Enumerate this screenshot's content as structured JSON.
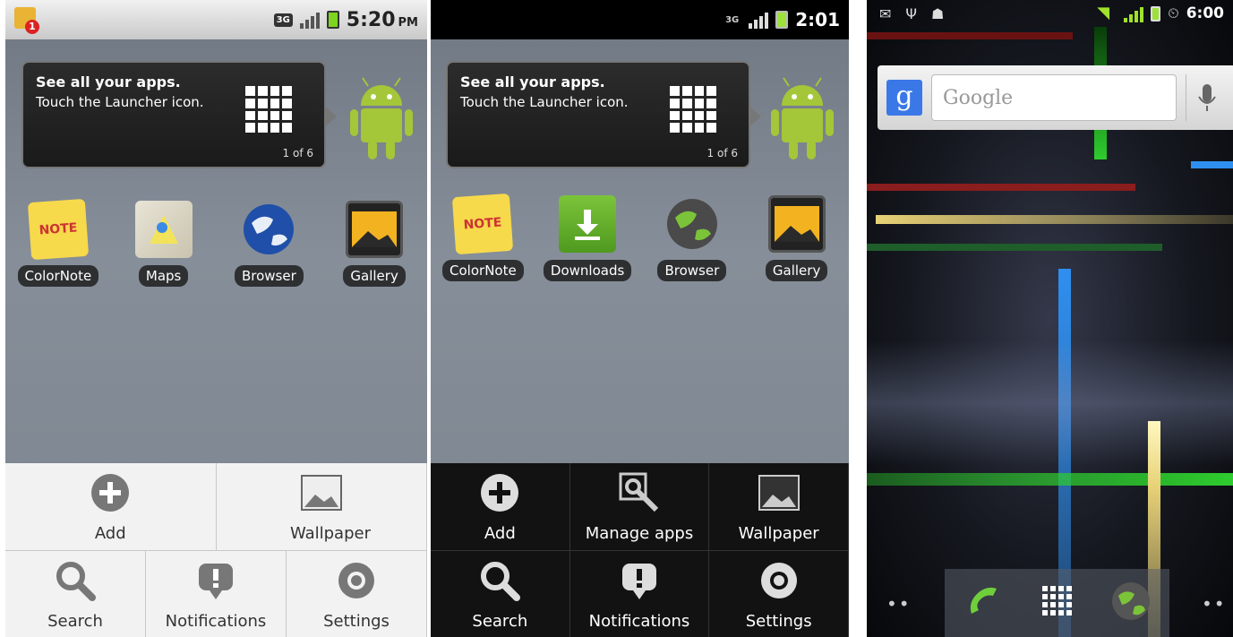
{
  "screen1": {
    "status": {
      "time": "5:20",
      "ampm": "PM",
      "network": "3G",
      "notification_count": "1"
    },
    "tip": {
      "title": "See all your apps.",
      "body": "Touch the Launcher icon.",
      "page": "1 of 6"
    },
    "apps": [
      {
        "label": "ColorNote",
        "icon": "note-icon"
      },
      {
        "label": "Maps",
        "icon": "maps-icon"
      },
      {
        "label": "Browser",
        "icon": "globe-icon"
      },
      {
        "label": "Gallery",
        "icon": "gallery-icon"
      }
    ],
    "menu": {
      "row1": [
        {
          "label": "Add",
          "icon": "add-icon"
        },
        {
          "label": "Wallpaper",
          "icon": "wallpaper-icon"
        }
      ],
      "row2": [
        {
          "label": "Search",
          "icon": "search-icon"
        },
        {
          "label": "Notifications",
          "icon": "notification-icon"
        },
        {
          "label": "Settings",
          "icon": "settings-icon"
        }
      ]
    }
  },
  "screen2": {
    "status": {
      "time": "2:01",
      "network": "3G"
    },
    "tip": {
      "title": "See all your apps.",
      "body": "Touch the Launcher icon.",
      "page": "1 of 6"
    },
    "apps": [
      {
        "label": "ColorNote",
        "icon": "note-icon"
      },
      {
        "label": "Downloads",
        "icon": "download-icon"
      },
      {
        "label": "Browser",
        "icon": "globe-icon"
      },
      {
        "label": "Gallery",
        "icon": "gallery-icon"
      }
    ],
    "menu": {
      "row1": [
        {
          "label": "Add",
          "icon": "add-icon"
        },
        {
          "label": "Manage apps",
          "icon": "manage-apps-icon"
        },
        {
          "label": "Wallpaper",
          "icon": "wallpaper-icon"
        }
      ],
      "row2": [
        {
          "label": "Search",
          "icon": "search-icon"
        },
        {
          "label": "Notifications",
          "icon": "notification-icon"
        },
        {
          "label": "Settings",
          "icon": "settings-icon"
        }
      ]
    }
  },
  "screen3": {
    "status": {
      "time": "6:00"
    },
    "search": {
      "logo": "g",
      "placeholder": "Google"
    },
    "dock": [
      {
        "icon": "phone-icon"
      },
      {
        "icon": "launcher-icon"
      },
      {
        "icon": "browser-icon"
      }
    ],
    "colors": {
      "green": "#2ecc2e",
      "blue": "#2f8ff0",
      "yellow": "#e8d277",
      "red": "#c22"
    }
  }
}
